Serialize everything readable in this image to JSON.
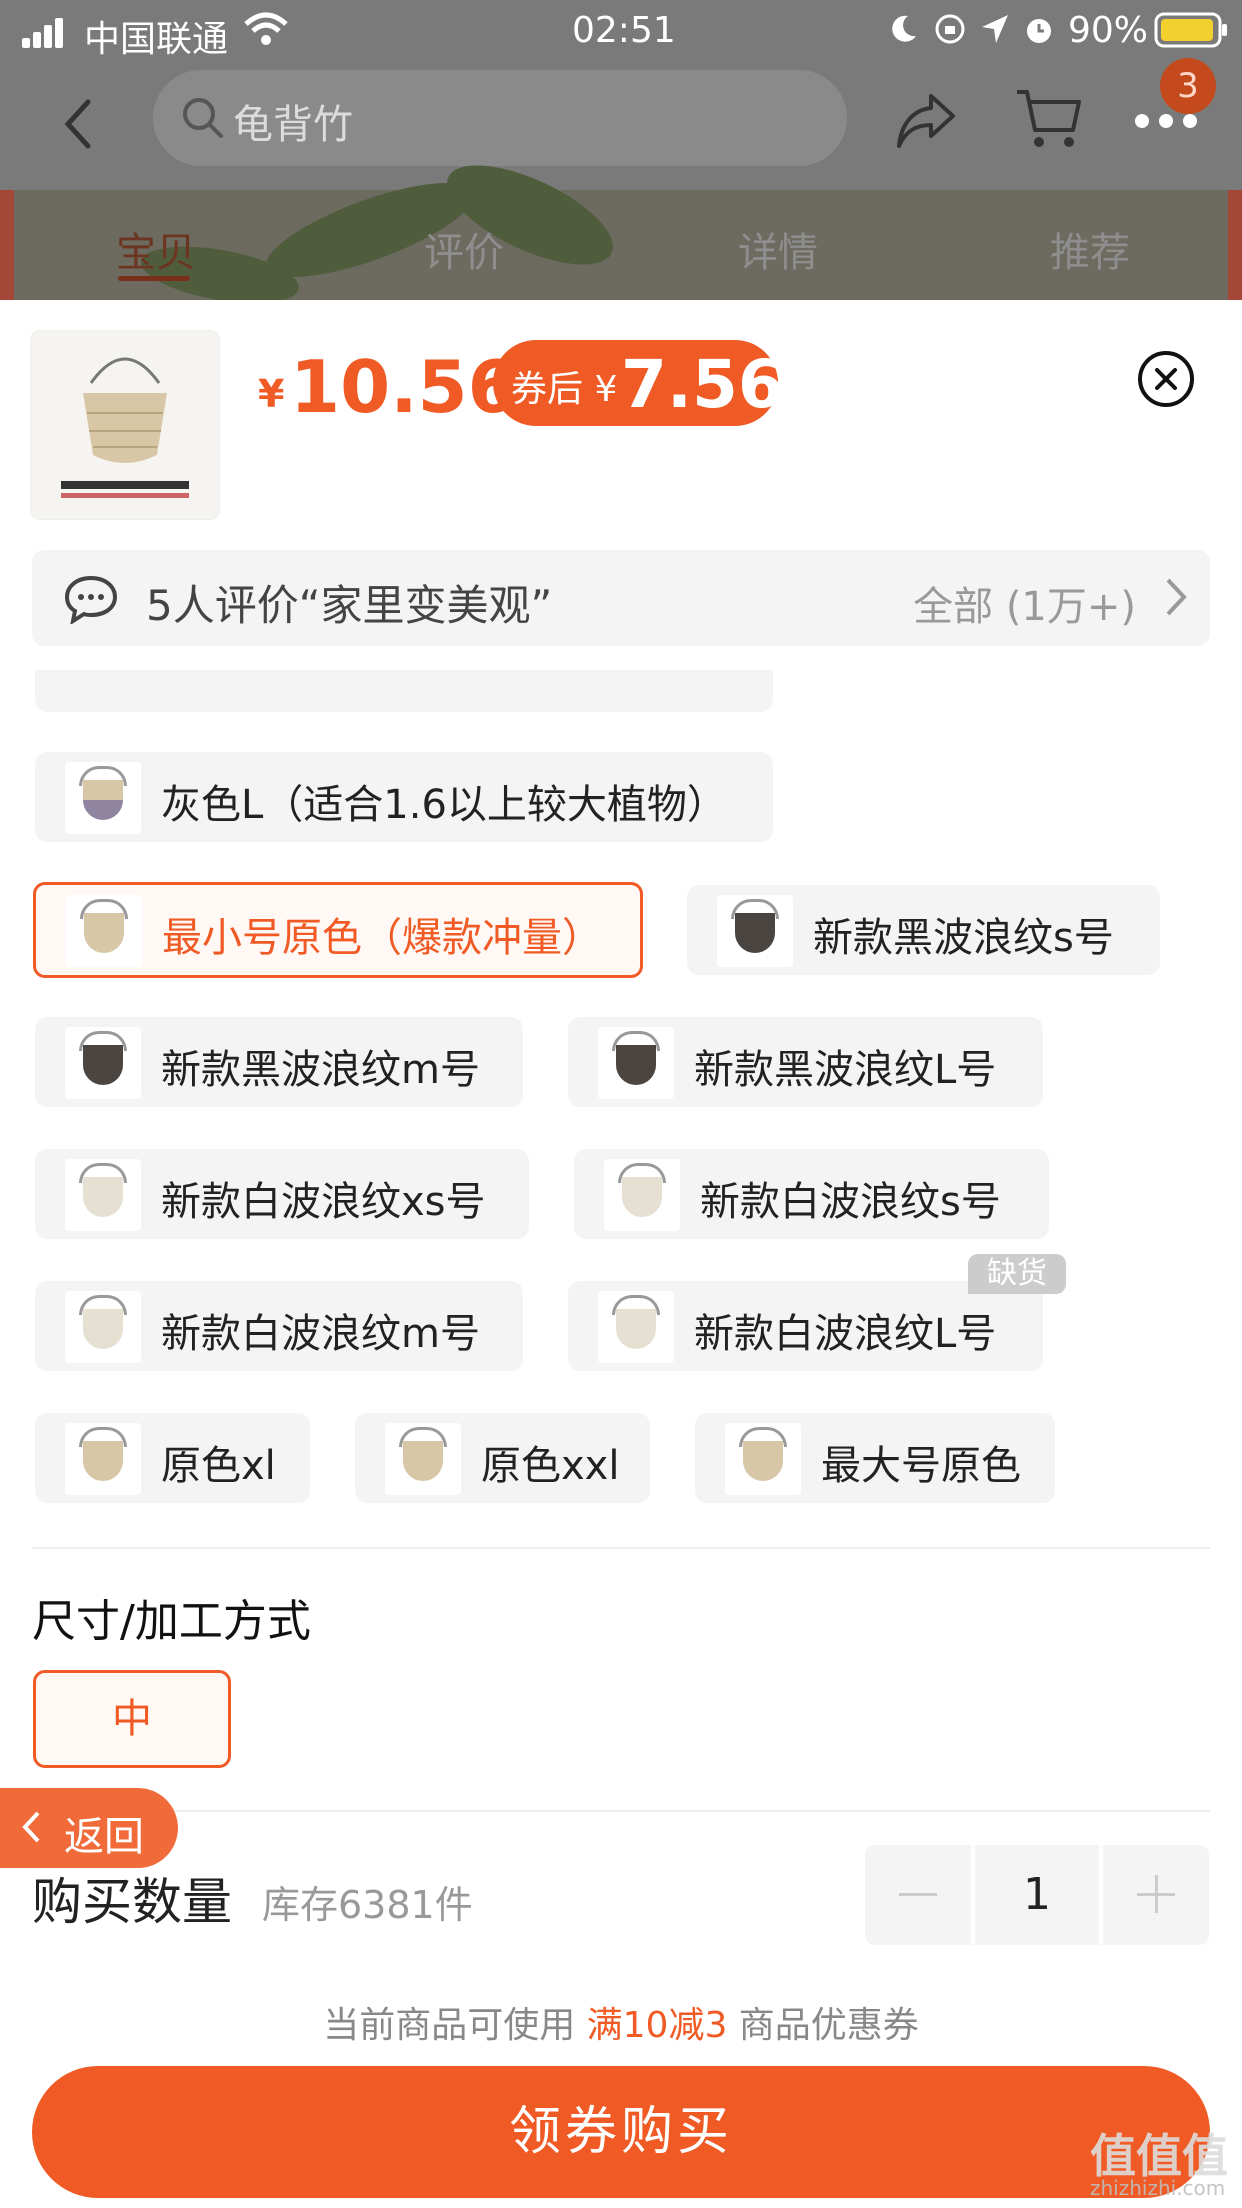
{
  "status_bar": {
    "carrier": "中国联通",
    "time": "02:51",
    "battery": "90%"
  },
  "nav": {
    "search_text": "龟背竹",
    "cart_badge": "3"
  },
  "tabs": [
    {
      "label": "宝贝",
      "active": true
    },
    {
      "label": "评价"
    },
    {
      "label": "详情"
    },
    {
      "label": "推荐"
    }
  ],
  "product": {
    "price_symbol": "¥",
    "price": "10.56",
    "coupon_label": "券后 ¥",
    "coupon_price": "7.56"
  },
  "review": {
    "text": "5人评价“家里变美观”",
    "all": "全部 (1万+)"
  },
  "options": [
    {
      "label": "灰色L（适合1.6以上较大植物）",
      "swatch": "grey"
    },
    {
      "label": "最小号原色（爆款冲量）",
      "swatch": "natural",
      "selected": true
    },
    {
      "label": "新款黑波浪纹s号",
      "swatch": "dark"
    },
    {
      "label": "新款黑波浪纹m号",
      "swatch": "dark"
    },
    {
      "label": "新款黑波浪纹L号",
      "swatch": "dark"
    },
    {
      "label": "新款白波浪纹xs号",
      "swatch": "white"
    },
    {
      "label": "新款白波浪纹s号",
      "swatch": "white"
    },
    {
      "label": "新款白波浪纹m号",
      "swatch": "white"
    },
    {
      "label": "新款白波浪纹L号",
      "swatch": "white",
      "badge": "缺货"
    },
    {
      "label": "原色xl",
      "swatch": "natural"
    },
    {
      "label": "原色xxl",
      "swatch": "natural"
    },
    {
      "label": "最大号原色",
      "swatch": "natural"
    }
  ],
  "size": {
    "title": "尺寸/加工方式",
    "option": "中"
  },
  "back_button": "返回",
  "quantity": {
    "title": "购买数量",
    "stock": "库存6381件",
    "value": "1"
  },
  "coupon_note": {
    "prefix": "当前商品可使用 ",
    "highlight": "满10减3",
    "suffix": " 商品优惠券"
  },
  "buy_button": "领券购买",
  "watermark": {
    "logo": "值值值",
    "url": "zhizhizhi.com"
  },
  "colors": {
    "accent": "#f05a24",
    "option_bg": "#f4f4f4"
  }
}
